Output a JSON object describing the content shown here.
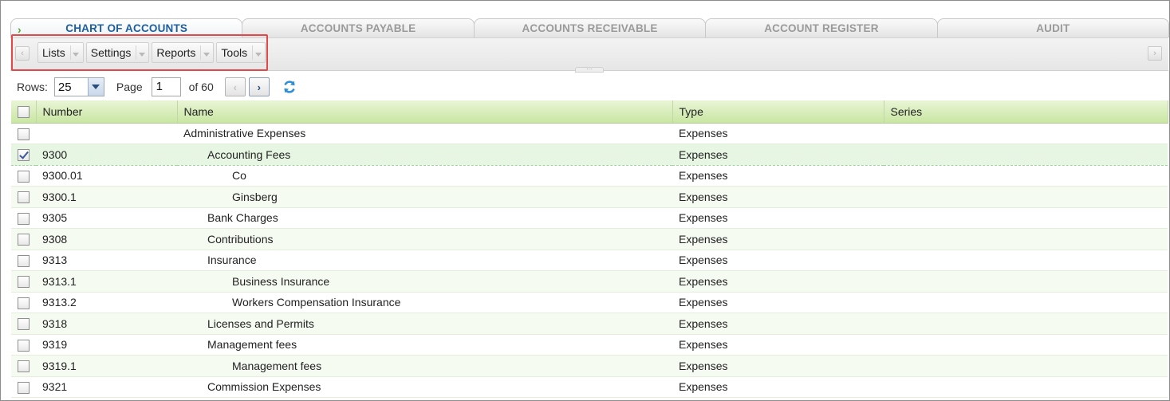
{
  "tabs": [
    {
      "label": "CHART OF ACCOUNTS",
      "active": true
    },
    {
      "label": "ACCOUNTS PAYABLE",
      "active": false
    },
    {
      "label": "ACCOUNTS RECEIVABLE",
      "active": false
    },
    {
      "label": "ACCOUNT REGISTER",
      "active": false
    },
    {
      "label": "AUDIT",
      "active": false
    }
  ],
  "toolbar": {
    "menus": [
      "Lists",
      "Settings",
      "Reports",
      "Tools"
    ]
  },
  "pager": {
    "rows_label": "Rows:",
    "rows_value": "25",
    "page_label": "Page",
    "page_value": "1",
    "of_label": "of 60"
  },
  "grid": {
    "columns": [
      "Number",
      "Name",
      "Type",
      "Series"
    ],
    "rows": [
      {
        "number": "",
        "name": "Administrative Expenses",
        "level": 0,
        "type": "Expenses",
        "series": "",
        "checked": false
      },
      {
        "number": "9300",
        "name": "Accounting Fees",
        "level": 1,
        "type": "Expenses",
        "series": "",
        "checked": true
      },
      {
        "number": "9300.01",
        "name": "Co",
        "level": 2,
        "type": "Expenses",
        "series": "",
        "checked": false
      },
      {
        "number": "9300.1",
        "name": "Ginsberg",
        "level": 2,
        "type": "Expenses",
        "series": "",
        "checked": false
      },
      {
        "number": "9305",
        "name": "Bank Charges",
        "level": 1,
        "type": "Expenses",
        "series": "",
        "checked": false
      },
      {
        "number": "9308",
        "name": "Contributions",
        "level": 1,
        "type": "Expenses",
        "series": "",
        "checked": false
      },
      {
        "number": "9313",
        "name": "Insurance",
        "level": 1,
        "type": "Expenses",
        "series": "",
        "checked": false
      },
      {
        "number": "9313.1",
        "name": "Business Insurance",
        "level": 2,
        "type": "Expenses",
        "series": "",
        "checked": false
      },
      {
        "number": "9313.2",
        "name": "Workers Compensation Insurance",
        "level": 2,
        "type": "Expenses",
        "series": "",
        "checked": false
      },
      {
        "number": "9318",
        "name": "Licenses and Permits",
        "level": 1,
        "type": "Expenses",
        "series": "",
        "checked": false
      },
      {
        "number": "9319",
        "name": "Management fees",
        "level": 1,
        "type": "Expenses",
        "series": "",
        "checked": false
      },
      {
        "number": "9319.1",
        "name": "Management fees",
        "level": 2,
        "type": "Expenses",
        "series": "",
        "checked": false
      },
      {
        "number": "9321",
        "name": "Commission Expenses",
        "level": 1,
        "type": "Expenses",
        "series": "",
        "checked": false
      }
    ]
  },
  "colors": {
    "active_tab": "#1d5e9e",
    "header_green": "#c9e6a2",
    "highlight_box": "#e0484a"
  },
  "icons": [
    "expand-arrow-icon",
    "scroll-left-icon",
    "scroll-right-icon",
    "prev-page-icon",
    "next-page-icon",
    "refresh-icon",
    "checkbox-icon"
  ]
}
